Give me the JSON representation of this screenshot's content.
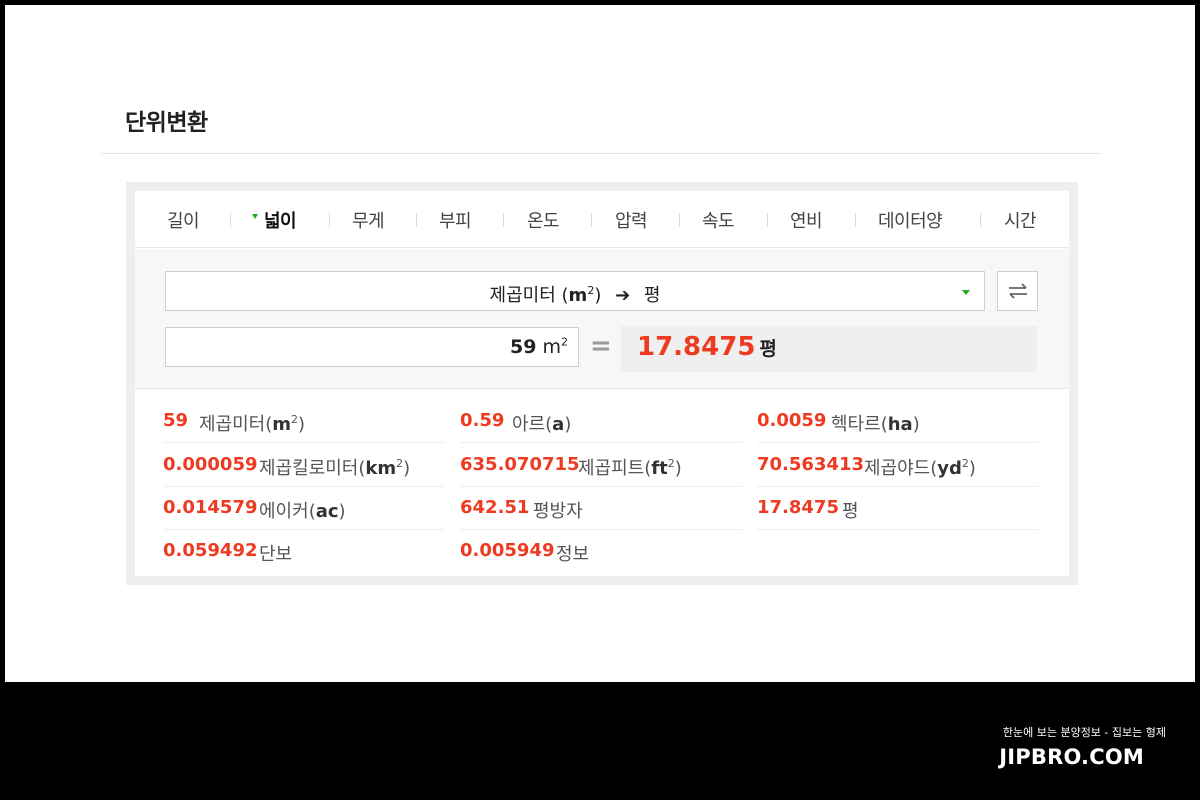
{
  "page_title": "단위변환",
  "tabs": [
    {
      "label": "길이",
      "active": false
    },
    {
      "label": "넓이",
      "active": true
    },
    {
      "label": "무게",
      "active": false
    },
    {
      "label": "부피",
      "active": false
    },
    {
      "label": "온도",
      "active": false
    },
    {
      "label": "압력",
      "active": false
    },
    {
      "label": "속도",
      "active": false
    },
    {
      "label": "연비",
      "active": false
    },
    {
      "label": "데이터양",
      "active": false
    },
    {
      "label": "시간",
      "active": false
    }
  ],
  "converter": {
    "from_unit": "제곱미터",
    "from_symbol_paren_open": "(",
    "from_symbol": "m",
    "from_symbol_sup": "2",
    "from_symbol_paren_close": ")",
    "to_unit": "평",
    "input_value": "59",
    "input_unit": "m",
    "input_unit_sup": "2",
    "equals": "=",
    "result_value": "17.8475",
    "result_unit": "평"
  },
  "results": [
    {
      "value": "59",
      "unit": "제곱미터",
      "sym_open": "(",
      "sym": "m",
      "sup": "2",
      "sym_close": ")"
    },
    {
      "value": "0.59",
      "unit": "아르",
      "sym_open": "(",
      "sym": "a",
      "sup": "",
      "sym_close": ")"
    },
    {
      "value": "0.0059",
      "unit": "헥타르",
      "sym_open": "(",
      "sym": "ha",
      "sup": "",
      "sym_close": ")"
    },
    {
      "value": "0.000059",
      "unit": "제곱킬로미터",
      "sym_open": "(",
      "sym": "km",
      "sup": "2",
      "sym_close": ")"
    },
    {
      "value": "635.070715",
      "unit": "제곱피트",
      "sym_open": "(",
      "sym": "ft",
      "sup": "2",
      "sym_close": ")"
    },
    {
      "value": "70.563413",
      "unit": "제곱야드",
      "sym_open": "(",
      "sym": "yd",
      "sup": "2",
      "sym_close": ")"
    },
    {
      "value": "0.014579",
      "unit": "에이커",
      "sym_open": "(",
      "sym": "ac",
      "sup": "",
      "sym_close": ")"
    },
    {
      "value": "642.51",
      "unit": "평방자",
      "sym_open": "",
      "sym": "",
      "sup": "",
      "sym_close": ""
    },
    {
      "value": "17.8475",
      "unit": "평",
      "sym_open": "",
      "sym": "",
      "sup": "",
      "sym_close": ""
    },
    {
      "value": "0.059492",
      "unit": "단보",
      "sym_open": "",
      "sym": "",
      "sup": "",
      "sym_close": ""
    },
    {
      "value": "0.005949",
      "unit": "정보",
      "sym_open": "",
      "sym": "",
      "sup": "",
      "sym_close": ""
    }
  ],
  "footer": {
    "tagline": "한눈에 보는 분양정보 - 집보는 형제",
    "brand": "JIPBRO.COM"
  },
  "colors": {
    "accent_red": "#ee3a21",
    "caret_green": "#22aa22"
  },
  "icons": {
    "swap": "swap-arrows-icon",
    "tab_caret": "caret-down-icon",
    "select_caret": "chevron-down-icon",
    "direction": "right-arrow-icon"
  }
}
